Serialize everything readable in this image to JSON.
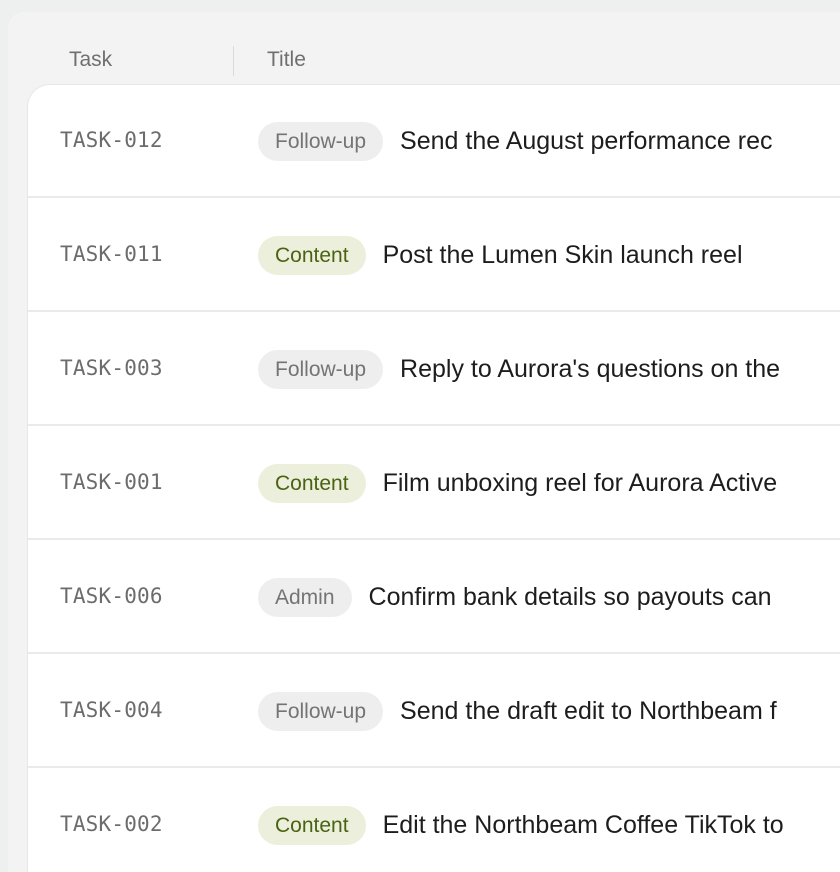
{
  "table": {
    "headers": {
      "task": "Task",
      "title": "Title"
    },
    "rows": [
      {
        "id": "TASK-012",
        "tag": "Follow-up",
        "tag_kind": "followup",
        "title": "Send the August performance rec"
      },
      {
        "id": "TASK-011",
        "tag": "Content",
        "tag_kind": "content",
        "title": "Post the Lumen Skin launch reel"
      },
      {
        "id": "TASK-003",
        "tag": "Follow-up",
        "tag_kind": "followup",
        "title": "Reply to Aurora's questions on the"
      },
      {
        "id": "TASK-001",
        "tag": "Content",
        "tag_kind": "content",
        "title": "Film unboxing reel for Aurora Active"
      },
      {
        "id": "TASK-006",
        "tag": "Admin",
        "tag_kind": "admin",
        "title": "Confirm bank details so payouts can"
      },
      {
        "id": "TASK-004",
        "tag": "Follow-up",
        "tag_kind": "followup",
        "title": "Send the draft edit to Northbeam f"
      },
      {
        "id": "TASK-002",
        "tag": "Content",
        "tag_kind": "content",
        "title": "Edit the Northbeam Coffee TikTok to"
      }
    ]
  },
  "colors": {
    "content_badge_bg": "#ecefdc",
    "content_badge_text": "#4a6312",
    "neutral_badge_bg": "#eeeeee",
    "neutral_badge_text": "#747474"
  }
}
